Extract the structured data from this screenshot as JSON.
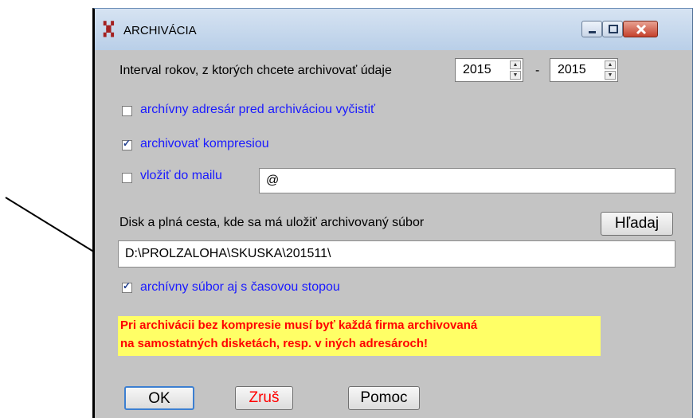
{
  "window": {
    "title": "ARCHIVÁCIA",
    "icon": "archive-app-icon",
    "controls": {
      "minimize": "minimize-icon",
      "maximize": "maximize-icon",
      "close": "close-icon"
    }
  },
  "interval": {
    "label": "Interval rokov, z ktorých chcete archivovať údaje",
    "from": "2015",
    "separator": "-",
    "to": "2015"
  },
  "options": {
    "clear_dir": {
      "label": "archívny adresár pred archiváciou vyčistiť",
      "checked": false
    },
    "compress": {
      "label": "archivovať kompresiou",
      "checked": true
    },
    "mail": {
      "label": "vložiť do mailu",
      "checked": false,
      "value": "@"
    },
    "timestamp": {
      "label": "archívny súbor aj s časovou stopou",
      "checked": true
    }
  },
  "path": {
    "label": "Disk a plná cesta, kde sa má uložiť archivovaný súbor",
    "browse_label": "Hľadaj",
    "value": "D:\\PROLZALOHA\\SKUSKA\\201511\\"
  },
  "warning": {
    "line1": "Pri archivácii bez kompresie musí byť každá firma archivovaná",
    "line2": "na samostatných disketách, resp. v iných adresároch!"
  },
  "buttons": {
    "ok": "OK",
    "cancel": "Zruš",
    "help": "Pomoc"
  },
  "colors": {
    "option_text": "#1a1aff",
    "warning_text": "#ff0000",
    "warning_bg": "#ffff66",
    "dialog_bg": "#c4c4c4"
  }
}
